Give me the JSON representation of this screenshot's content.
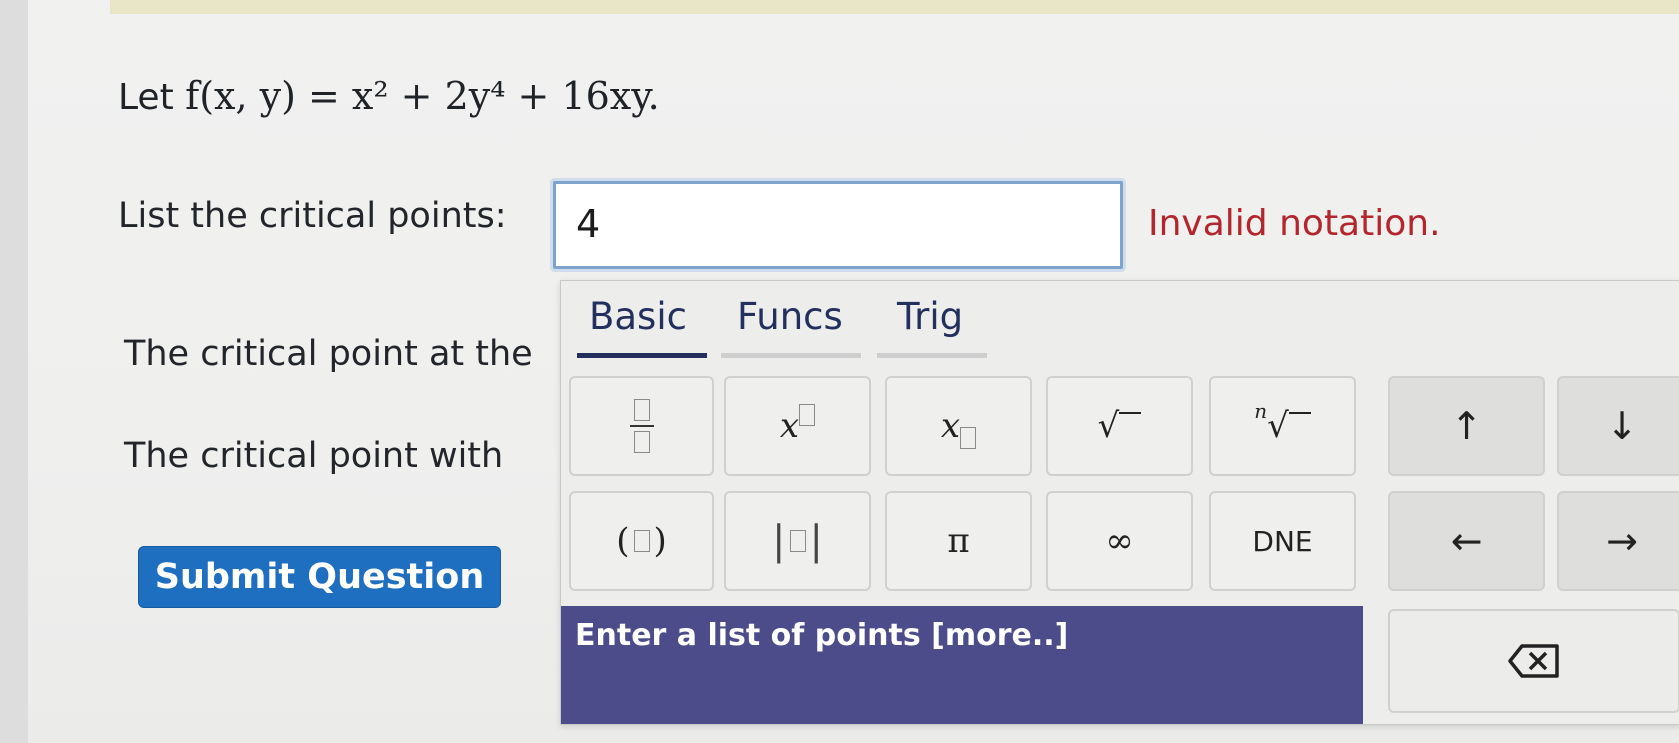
{
  "problem": {
    "prefix": "Let",
    "function_text": "f(x, y) = x² + 2y⁴ + 16xy."
  },
  "critical_points": {
    "label": "List the critical points:",
    "input_value": "4",
    "error": "Invalid notation."
  },
  "partial_rows": [
    {
      "label": "The critical point at the"
    },
    {
      "label": "The critical point with"
    }
  ],
  "submit": {
    "label": "Submit Question"
  },
  "keypad": {
    "tabs": [
      {
        "label": "Basic",
        "active": true
      },
      {
        "label": "Funcs",
        "active": false
      },
      {
        "label": "Trig",
        "active": false
      }
    ],
    "keys": {
      "fraction": "fraction",
      "power": "x",
      "subscript": "x",
      "sqrt": "√",
      "nth_root_index": "n",
      "nth_root": "√",
      "up": "↑",
      "down": "↓",
      "parens_open": "(",
      "parens_close": ")",
      "abs": "| |",
      "pi": "π",
      "infinity": "∞",
      "dne": "DNE",
      "left": "←",
      "right": "→"
    },
    "help_text": "Enter a list of points [more..]"
  },
  "colors": {
    "accent": "#1f6fc0",
    "error": "#b3262d",
    "help_bar": "#4c4c8a",
    "tab_active": "#23305e"
  }
}
